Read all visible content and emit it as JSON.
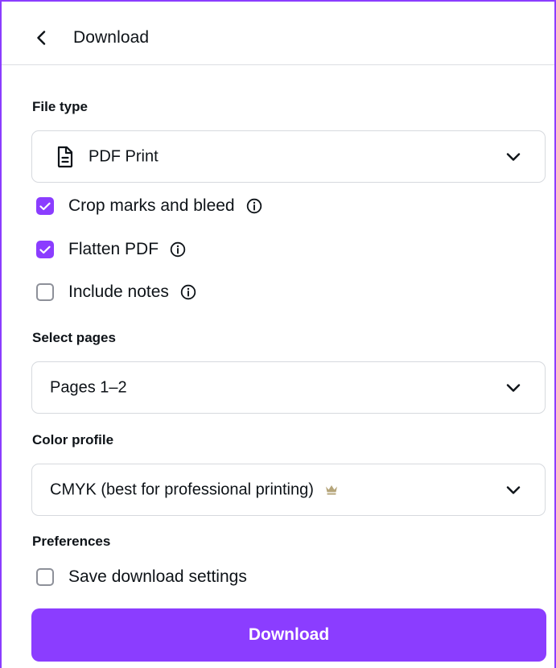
{
  "header": {
    "back_icon": "chevron-left-icon",
    "title": "Download"
  },
  "file_type": {
    "label": "File type",
    "icon": "file-document-icon",
    "value": "PDF Print"
  },
  "options": [
    {
      "label": "Crop marks and bleed",
      "checked": true,
      "info_icon": "info-icon"
    },
    {
      "label": "Flatten PDF",
      "checked": true,
      "info_icon": "info-icon"
    },
    {
      "label": "Include notes",
      "checked": false,
      "info_icon": "info-icon"
    }
  ],
  "select_pages": {
    "label": "Select pages",
    "value": "Pages 1–2"
  },
  "color_profile": {
    "label": "Color profile",
    "value": "CMYK (best for professional printing)",
    "premium_icon": "crown-icon"
  },
  "preferences": {
    "label": "Preferences",
    "save_settings": {
      "label": "Save download settings",
      "checked": false
    }
  },
  "download_button": {
    "label": "Download"
  },
  "colors": {
    "accent": "#8b3dff",
    "border": "#d6d9de",
    "text": "#0e1318"
  }
}
